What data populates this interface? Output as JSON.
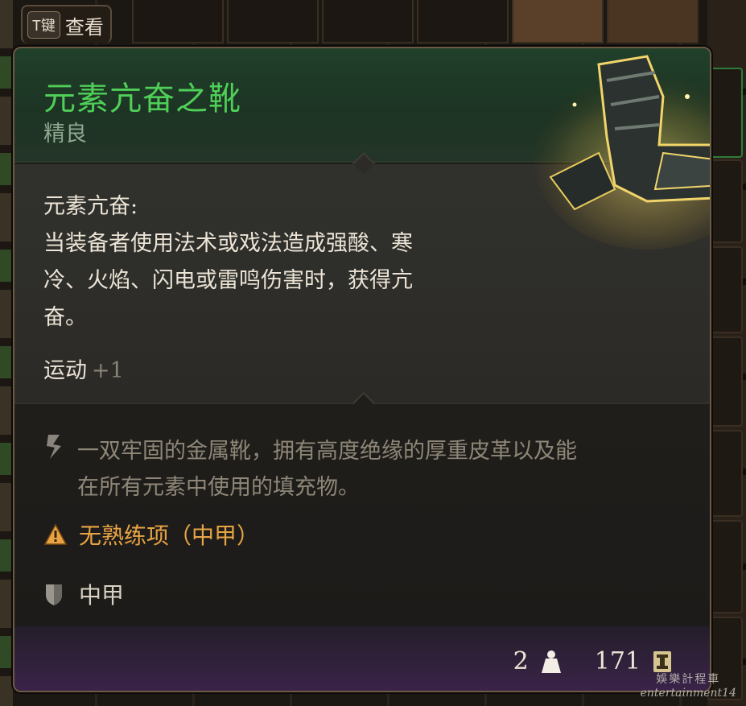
{
  "key_hint": {
    "key": "T键",
    "label": "查看"
  },
  "item": {
    "name": "元素亢奋之靴",
    "rarity": "精良",
    "name_color": "#4fcf57",
    "ability": {
      "title": "元素亢奋:",
      "lines": [
        "当装备者使用法术或戏法造成强酸、寒",
        "冷、火焰、闪电或雷鸣伤害时，获得亢",
        "奋。"
      ]
    },
    "stat": {
      "name": "运动",
      "value": "+1"
    },
    "lore": [
      "一双牢固的金属靴，拥有高度绝缘的厚重皮革以及能",
      "在所有元素中使用的填充物。"
    ],
    "proficiency_warning": "无熟练项（中甲）",
    "armor_type": "中甲",
    "weight": "2",
    "price": "171"
  },
  "icons": {
    "warning": "warning-triangle-icon",
    "lore": "quill-icon",
    "armor": "shield-icon",
    "weight": "weight-icon",
    "price": "gold-coin-icon"
  },
  "watermark": {
    "cn": "娛樂計程車",
    "en": "entertainment14"
  }
}
